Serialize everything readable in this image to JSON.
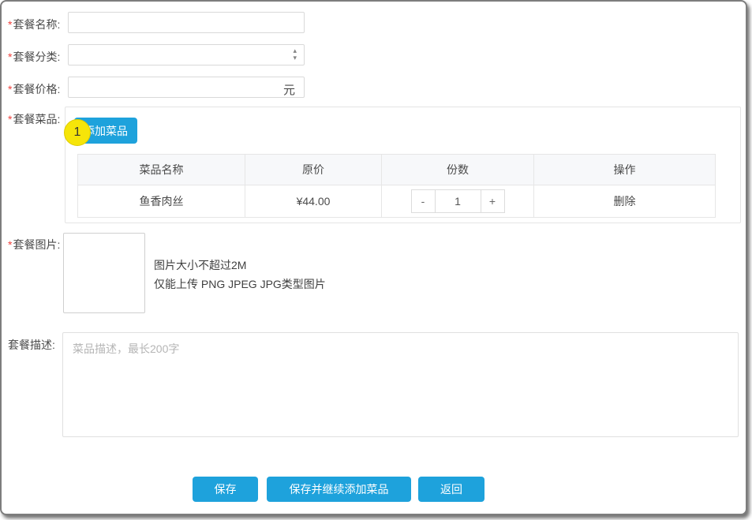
{
  "form": {
    "fields": {
      "name": {
        "required": "*",
        "label": "套餐名称:"
      },
      "category": {
        "required": "*",
        "label": "套餐分类:"
      },
      "price": {
        "required": "*",
        "label": "套餐价格:",
        "unit": "元"
      },
      "dishes": {
        "required": "*",
        "label": "套餐菜品:"
      },
      "image": {
        "required": "*",
        "label": "套餐图片:",
        "hint_line1": "图片大小不超过2M",
        "hint_line2": "仅能上传 PNG JPEG JPG类型图片"
      },
      "description": {
        "label": "套餐描述:",
        "placeholder": "菜品描述，最长200字"
      }
    },
    "dishes_section": {
      "add_button_label": "添加菜品",
      "badge_number": "1",
      "table": {
        "headers": [
          "菜品名称",
          "原价",
          "份数",
          "操作"
        ],
        "rows": [
          {
            "name": "鱼香肉丝",
            "price": "¥44.00",
            "quantity": "1",
            "action": "删除"
          }
        ]
      },
      "stepper": {
        "minus": "-",
        "plus": "+"
      }
    },
    "buttons": {
      "save": "保存",
      "save_and_continue": "保存并继续添加菜品",
      "back": "返回"
    },
    "colors": {
      "accent_blue": "#1ea2dc",
      "badge_yellow": "#f6e509",
      "required_red": "#f0413d"
    }
  }
}
